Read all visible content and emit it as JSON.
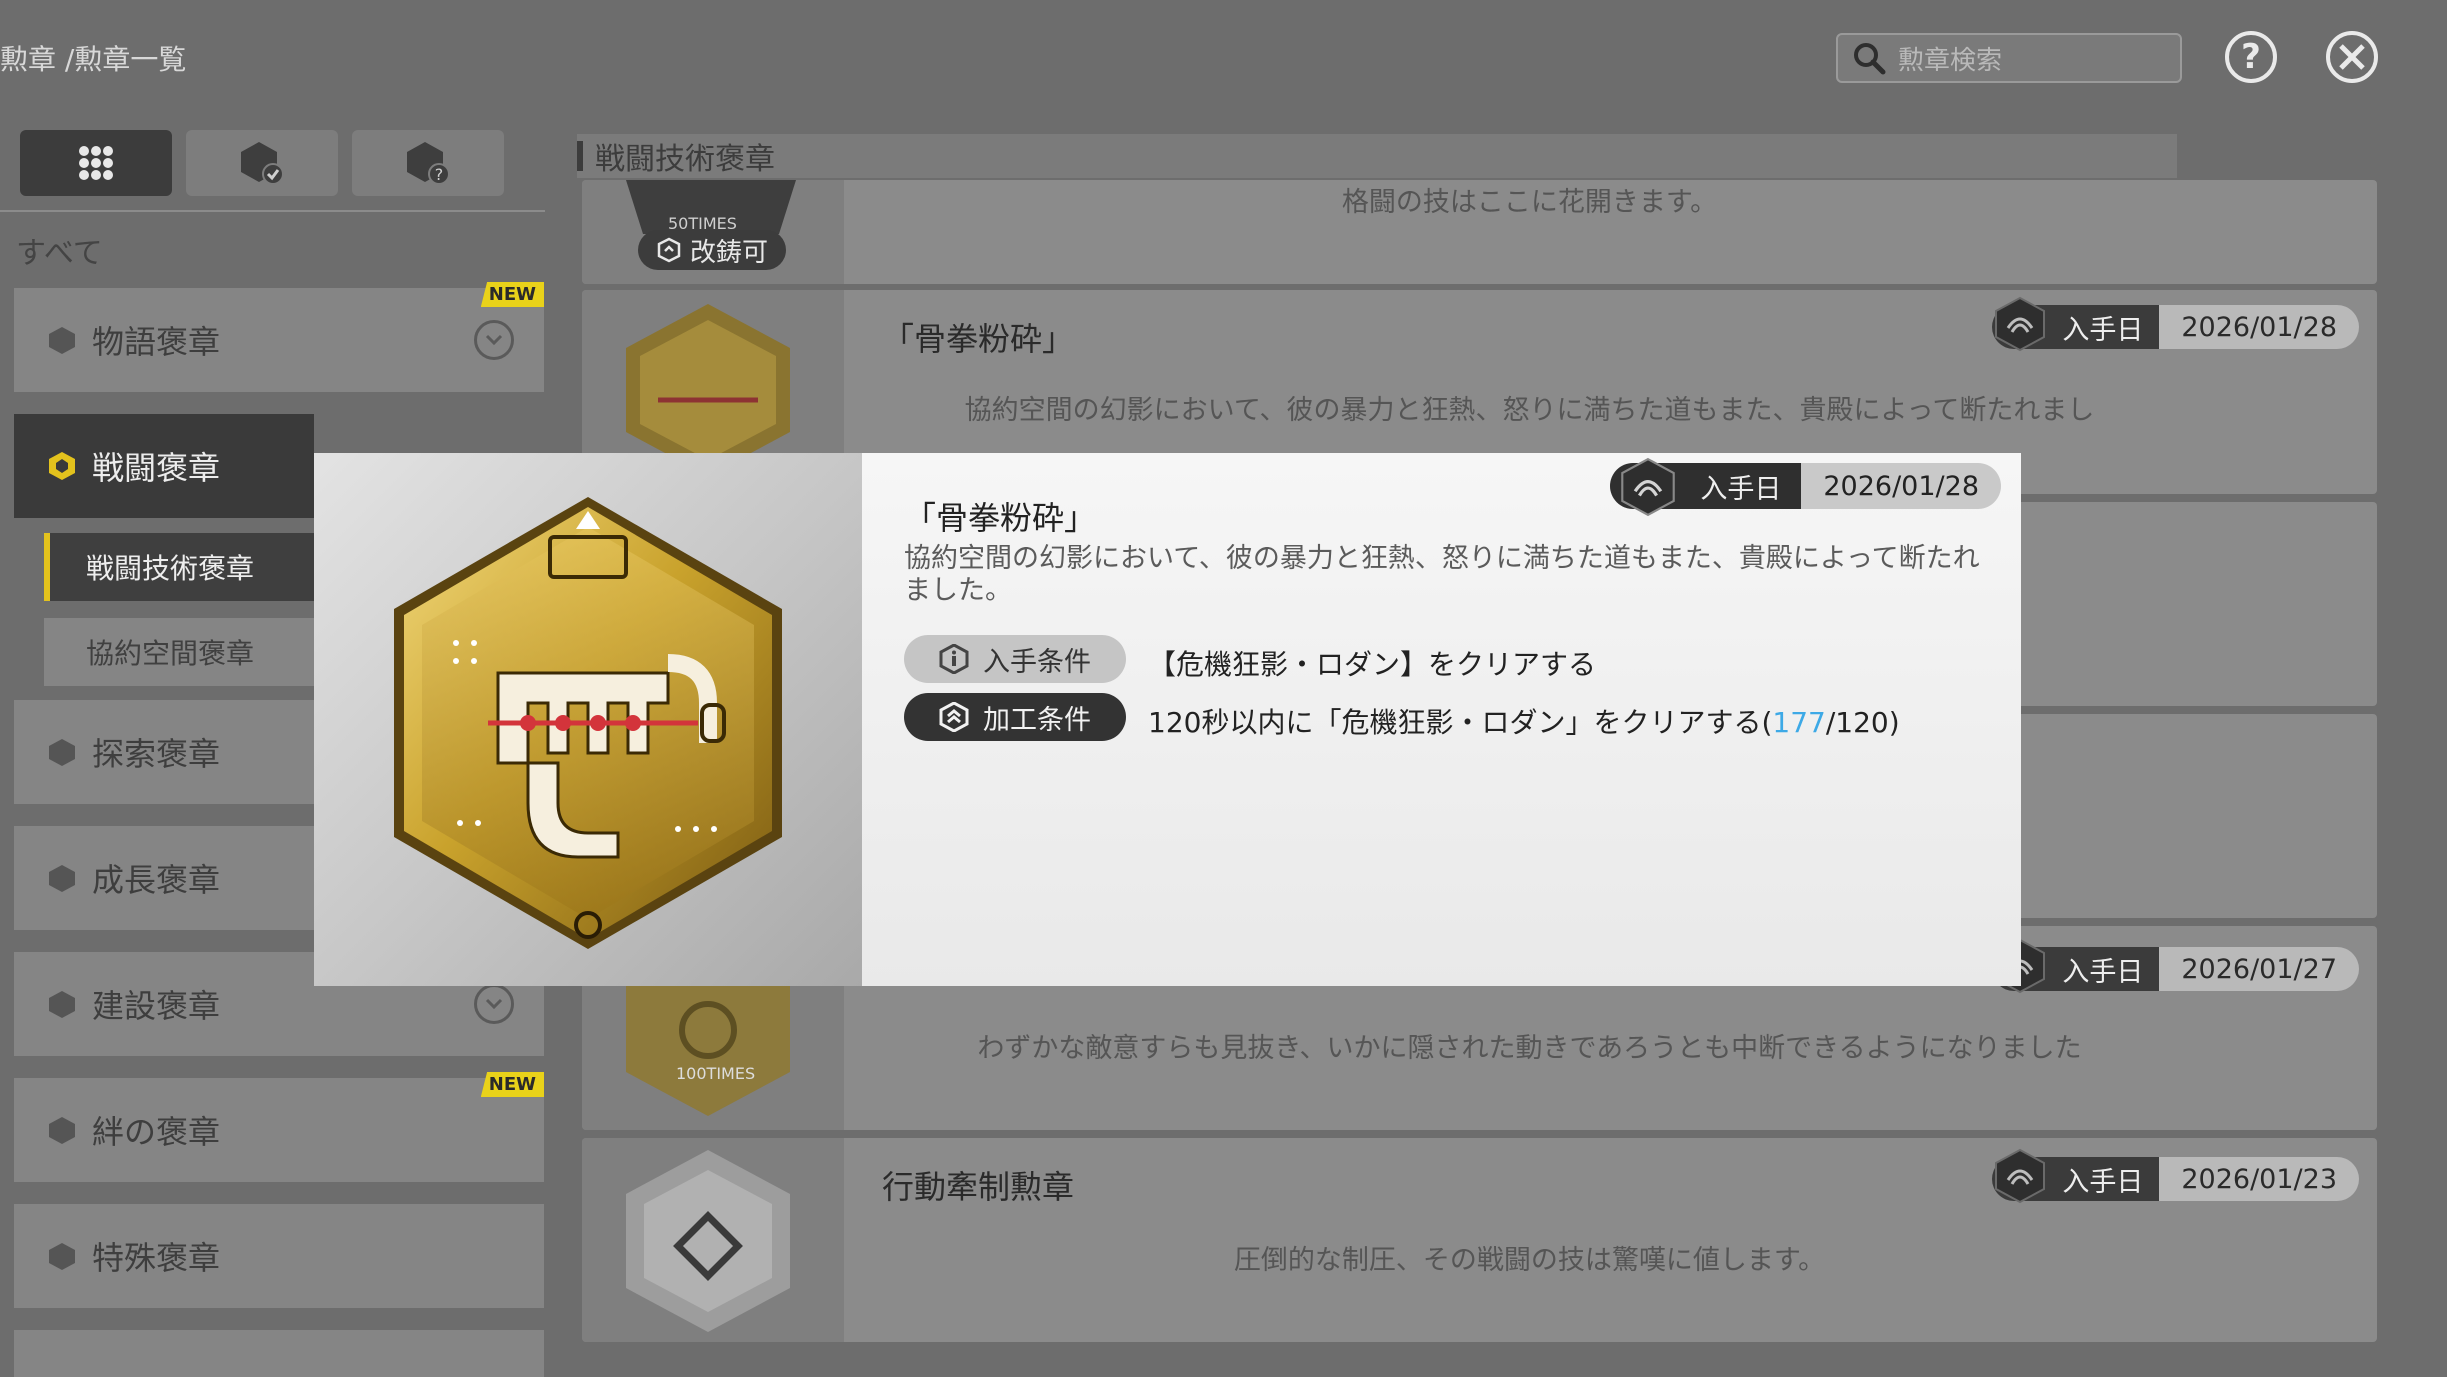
{
  "breadcrumb": "勲章 /勲章一覧",
  "search": {
    "placeholder": "勲章検索"
  },
  "top_icons": {
    "help": "?",
    "close": "close"
  },
  "filter_tabs": [
    {
      "icon": "grid-icon",
      "active": true
    },
    {
      "icon": "medal-check-icon",
      "active": false
    },
    {
      "icon": "medal-question-icon",
      "active": false
    }
  ],
  "sidebar": {
    "all_label": "すべて",
    "categories": [
      {
        "label": "物語褒章",
        "new": "NEW",
        "expand": true
      },
      {
        "label": "戦闘褒章",
        "active": true
      },
      {
        "label": "探索褒章"
      },
      {
        "label": "成長褒章"
      },
      {
        "label": "建設褒章",
        "expand": true
      },
      {
        "label": "絆の褒章",
        "new": "NEW"
      },
      {
        "label": "特殊褒章"
      }
    ],
    "sub_items": [
      {
        "label": "戦闘技術褒章",
        "active": true
      },
      {
        "label": "協約空間褒章"
      }
    ]
  },
  "section_title": "戦闘技術褒章",
  "list": {
    "date_label": "入手日",
    "card0": {
      "desc": "格闘の技はここに花開きます。",
      "thumb_text": "50TIMES",
      "badge": "改鋳可"
    },
    "card1": {
      "name": "「骨拳粉砕」",
      "desc": "協約空間の幻影において、彼の暴力と狂熱、怒りに満ちた道もまた、貴殿によって断たれまし",
      "date": "2026/01/28"
    },
    "card4": {
      "desc": "わずかな敵意すらも見抜き、いかに隠された動きであろうとも中断できるようになりました",
      "date": "2026/01/27",
      "thumb_text": "100TIMES"
    },
    "card5": {
      "name": "行動牽制勲章",
      "desc": "圧倒的な制圧、その戦闘の技は驚嘆に値します。",
      "date": "2026/01/23"
    }
  },
  "modal": {
    "title": "「骨拳粉砕」",
    "date_label": "入手日",
    "date": "2026/01/28",
    "desc": "協約空間の幻影において、彼の暴力と狂熱、怒りに満ちた道もまた、貴殿によって断たれました。",
    "acquire_label": "入手条件",
    "acquire_text": "【危機狂影・ロダン】をクリアする",
    "craft_label": "加工条件",
    "craft_text": "120秒以内に「危機狂影・ロダン」をクリアする(",
    "craft_progress": "177",
    "craft_total": "/120)"
  },
  "colors": {
    "accent_yellow": "#e3c21d",
    "progress_blue": "#3da9e6",
    "medal_gold": "#c9a22c"
  }
}
